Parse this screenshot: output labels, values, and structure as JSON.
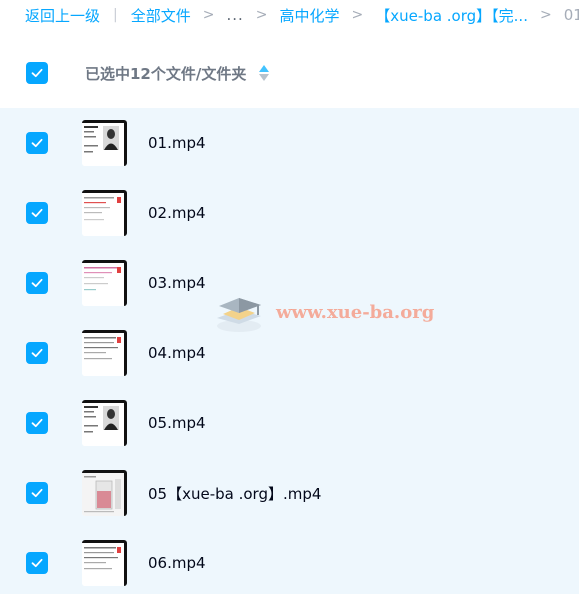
{
  "breadcrumb": {
    "back_label": "返回上一级",
    "all_files_label": "全部文件",
    "ellipsis": "...",
    "folder_1": "高中化学",
    "folder_2": "【xue-ba .org】【完...",
    "current": "01",
    "separator": ">"
  },
  "header": {
    "selection_label": "已选中12个文件/文件夹",
    "sort_icon": "sort-updown-icon"
  },
  "files": [
    {
      "name": "01.mp4",
      "thumb": "portrait",
      "checked": true
    },
    {
      "name": "02.mp4",
      "thumb": "slide-red",
      "checked": true
    },
    {
      "name": "03.mp4",
      "thumb": "slide-pink",
      "checked": true
    },
    {
      "name": "04.mp4",
      "thumb": "slide-text",
      "checked": true
    },
    {
      "name": "05.mp4",
      "thumb": "portrait",
      "checked": true
    },
    {
      "name": "05【xue-ba .org】.mp4",
      "thumb": "beaker",
      "checked": true
    },
    {
      "name": "06.mp4",
      "thumb": "slide-text",
      "checked": true
    }
  ],
  "watermark": {
    "text": "www.xue-ba.org",
    "icon": "graduation-cap-icon"
  },
  "colors": {
    "accent": "#06a7ff",
    "selected_row_bg": "#eef7fd",
    "text_primary": "#03081a",
    "text_muted": "#6f7885",
    "watermark": "#f69278"
  }
}
